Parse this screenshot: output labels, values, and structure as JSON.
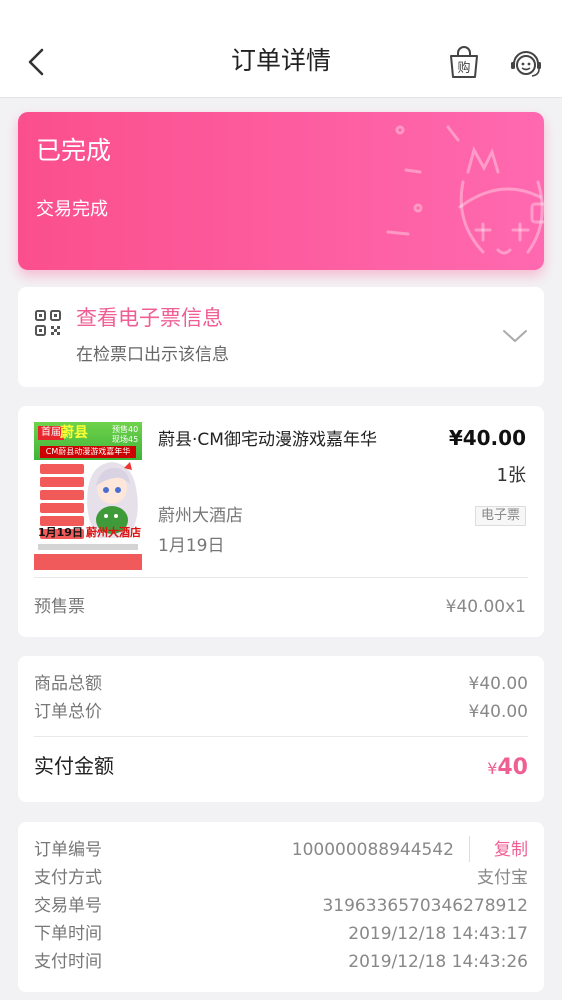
{
  "nav": {
    "title": "订单详情",
    "back_icon": "chevron-left-icon",
    "cart_icon": "shopping-bag-icon",
    "cart_icon_text": "购",
    "service_icon": "customer-service-icon"
  },
  "status": {
    "title": "已完成",
    "subtitle": "交易完成"
  },
  "eticket": {
    "title": "查看电子票信息",
    "subtitle": "在检票口出示该信息"
  },
  "product": {
    "name": "蔚县·CM御宅动漫游戏嘉年华",
    "price": "¥40.00",
    "quantity": "1张",
    "venue": "蔚州大酒店",
    "tag": "电子票",
    "date": "1月19日",
    "ticket_type": "预售票",
    "ticket_line": "¥40.00x1",
    "poster": {
      "badge": "首届",
      "county": "蔚县",
      "price_note": "预售40 现场45",
      "banner": "CM蔚县动漫游戏嘉年华",
      "date": "1月19日",
      "hotel": "蔚州大酒店"
    }
  },
  "summary": {
    "goods_total_label": "商品总额",
    "goods_total_value": "¥40.00",
    "order_total_label": "订单总价",
    "order_total_value": "¥40.00",
    "paid_label": "实付金额",
    "paid_currency": "¥",
    "paid_amount": "40"
  },
  "order_info": {
    "order_no_label": "订单编号",
    "order_no_value": "100000088944542",
    "copy_label": "复制",
    "pay_method_label": "支付方式",
    "pay_method_value": "支付宝",
    "trade_no_label": "交易单号",
    "trade_no_value": "3196336570346278912",
    "order_time_label": "下单时间",
    "order_time_value": "2019/12/18 14:43:17",
    "pay_time_label": "支付时间",
    "pay_time_value": "2019/12/18 14:43:26"
  },
  "colors": {
    "accent": "#ef5f94",
    "status_gradient_start": "#fb4f8c",
    "status_gradient_end": "#ff69b0"
  }
}
